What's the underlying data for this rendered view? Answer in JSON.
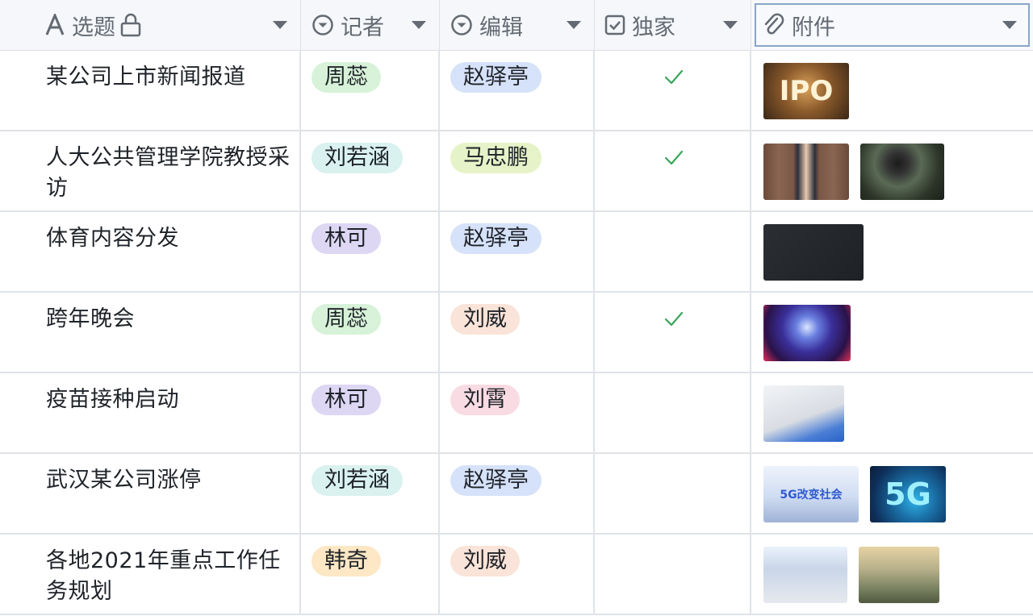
{
  "columns": {
    "title": "选题",
    "reporter": "记者",
    "editor": "编辑",
    "exclusive": "独家",
    "attachment": "附件"
  },
  "icons": {
    "title": "text-a-icon",
    "title_lock": "lock-icon",
    "reporter": "single-select-icon",
    "editor": "single-select-icon",
    "exclusive": "checkbox-icon",
    "attachment": "paperclip-icon",
    "dropdown": "caret-down-icon"
  },
  "tag_colors": {
    "周蕊": "#d7f2d8",
    "刘若涵": "#d9f1ef",
    "林可": "#ddd7f4",
    "韩奇": "#fde7c4",
    "赵驿亭": "#d6e2f9",
    "马忠鹏": "#e6f3c8",
    "刘威": "#fae3d8",
    "刘霄": "#f9dbe3"
  },
  "rows": [
    {
      "title": "某公司上市新闻报道",
      "reporter": "周蕊",
      "editor": "赵驿亭",
      "exclusive": true,
      "attachments": [
        {
          "name": "ipo-wood-blocks-image",
          "label": "IPO"
        }
      ]
    },
    {
      "title": "人大公共管理学院教授采访",
      "reporter": "刘若涵",
      "editor": "马忠鹏",
      "exclusive": true,
      "attachments": [
        {
          "name": "professor-portrait-image",
          "label": ""
        },
        {
          "name": "press-microphone-image",
          "label": ""
        }
      ]
    },
    {
      "title": "体育内容分发",
      "reporter": "林可",
      "editor": "赵驿亭",
      "exclusive": false,
      "attachments": [
        {
          "name": "distribution-diagram-image",
          "label": ""
        }
      ]
    },
    {
      "title": "跨年晚会",
      "reporter": "周蕊",
      "editor": "刘威",
      "exclusive": true,
      "attachments": [
        {
          "name": "concert-stage-image",
          "label": ""
        }
      ]
    },
    {
      "title": "疫苗接种启动",
      "reporter": "林可",
      "editor": "刘霄",
      "exclusive": false,
      "attachments": [
        {
          "name": "vaccine-syringe-image",
          "label": ""
        }
      ]
    },
    {
      "title": "武汉某公司涨停",
      "reporter": "刘若涵",
      "editor": "赵驿亭",
      "exclusive": false,
      "attachments": [
        {
          "name": "5g-exhibition-image",
          "label": "5G改变社会"
        },
        {
          "name": "5g-network-image",
          "label": "5G"
        }
      ]
    },
    {
      "title": "各地2021年重点工作任务规划",
      "reporter": "韩奇",
      "editor": "刘威",
      "exclusive": false,
      "attachments": [
        {
          "name": "regional-map-image",
          "label": ""
        },
        {
          "name": "city-aerial-image",
          "label": ""
        }
      ]
    }
  ]
}
